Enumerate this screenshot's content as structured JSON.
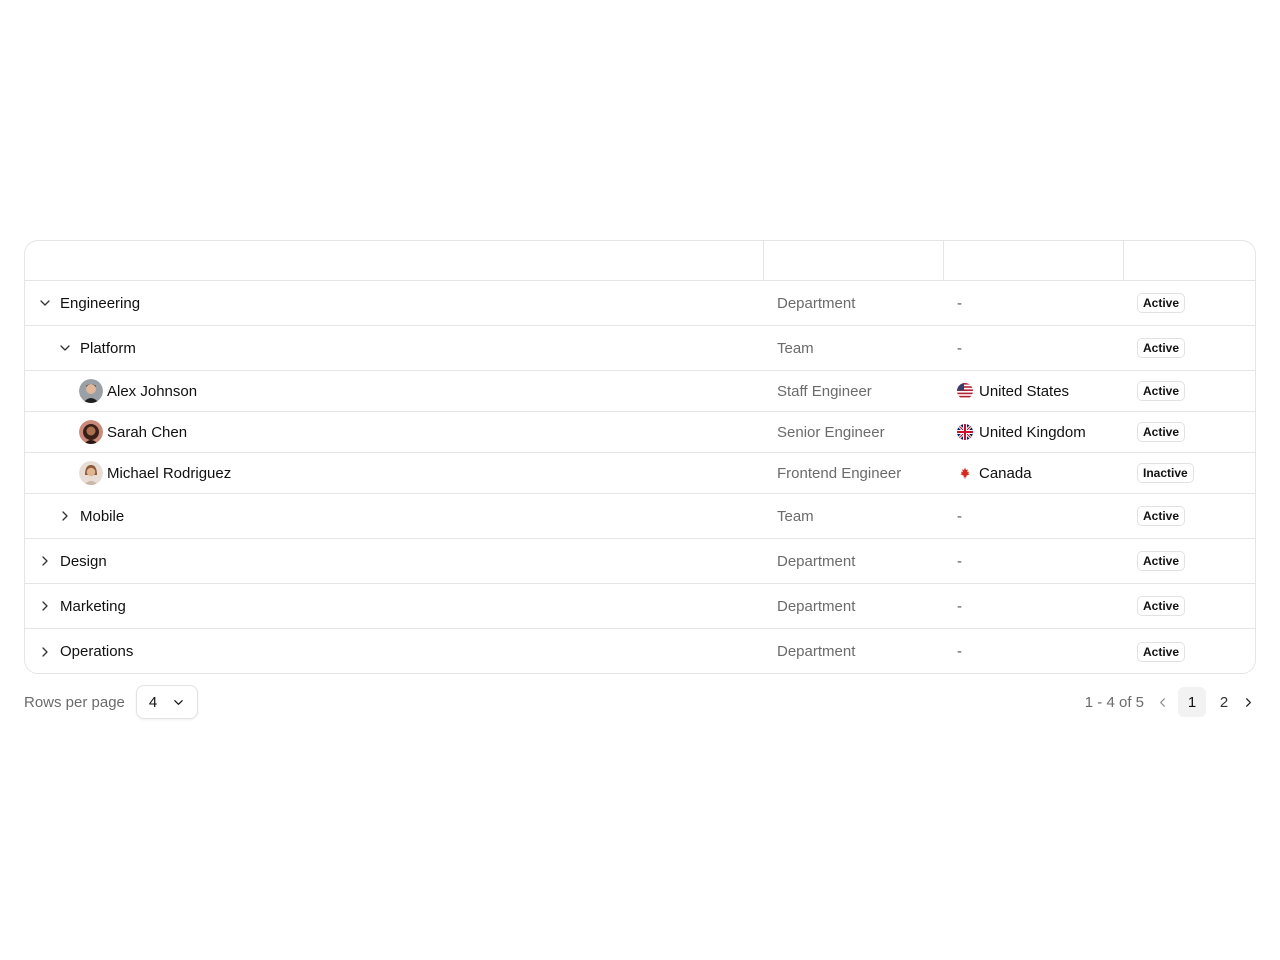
{
  "table": {
    "rows": [
      {
        "name": "Engineering",
        "type": "Department",
        "location": "-",
        "status": "Active",
        "expanded": true
      },
      {
        "name": "Platform",
        "type": "Team",
        "location": "-",
        "status": "Active",
        "expanded": true
      },
      {
        "name": "Alex Johnson",
        "type": "Staff Engineer",
        "location": "United States",
        "status": "Active"
      },
      {
        "name": "Sarah Chen",
        "type": "Senior Engineer",
        "location": "United Kingdom",
        "status": "Active"
      },
      {
        "name": "Michael Rodriguez",
        "type": "Frontend Engineer",
        "location": "Canada",
        "status": "Inactive"
      },
      {
        "name": "Mobile",
        "type": "Team",
        "location": "-",
        "status": "Active",
        "expanded": false
      },
      {
        "name": "Design",
        "type": "Department",
        "location": "-",
        "status": "Active",
        "expanded": false
      },
      {
        "name": "Marketing",
        "type": "Department",
        "location": "-",
        "status": "Active",
        "expanded": false
      },
      {
        "name": "Operations",
        "type": "Department",
        "location": "-",
        "status": "Active",
        "expanded": false
      }
    ]
  },
  "footer": {
    "rows_per_page_label": "Rows per page",
    "rows_per_page_value": "4",
    "range_text": "1 - 4 of 5",
    "pages": [
      "1",
      "2"
    ],
    "current_page": "1"
  },
  "icons": {
    "expanded": "chevron-down-icon",
    "collapsed": "chevron-right-icon",
    "select": "chevron-down-icon",
    "prev": "chevron-left-icon",
    "next": "chevron-right-icon",
    "flags": [
      "us-flag-icon",
      "uk-flag-icon",
      "canada-flag-icon"
    ]
  }
}
